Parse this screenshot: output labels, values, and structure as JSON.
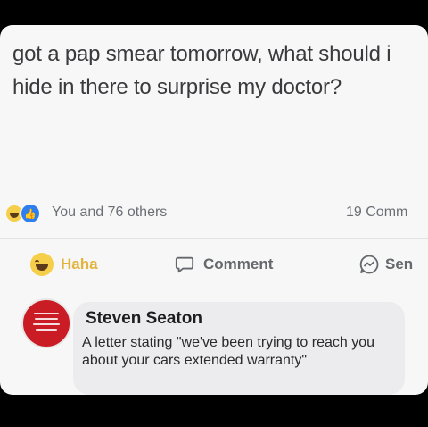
{
  "post": {
    "text": "got a pap smear tomorrow, what should i hide in there to surprise my doctor?"
  },
  "reactions": {
    "summary": "You and 76 others",
    "comments_count": "19 Comm"
  },
  "actions": {
    "haha_label": "Haha",
    "comment_label": "Comment",
    "send_label": "Sen"
  },
  "comment": {
    "author": "Steven Seaton",
    "text": "A letter stating \"we've been trying to reach you about your cars extended warranty\""
  },
  "colors": {
    "background": "#000000",
    "card": "#f7f7f8",
    "like_blue": "#2d7ff0",
    "haha_yellow": "#f5cf4a",
    "avatar_red": "#c91c24"
  },
  "icons": [
    "haha-reaction-icon",
    "like-reaction-icon",
    "haha-icon",
    "comment-icon",
    "send-icon",
    "avatar"
  ]
}
